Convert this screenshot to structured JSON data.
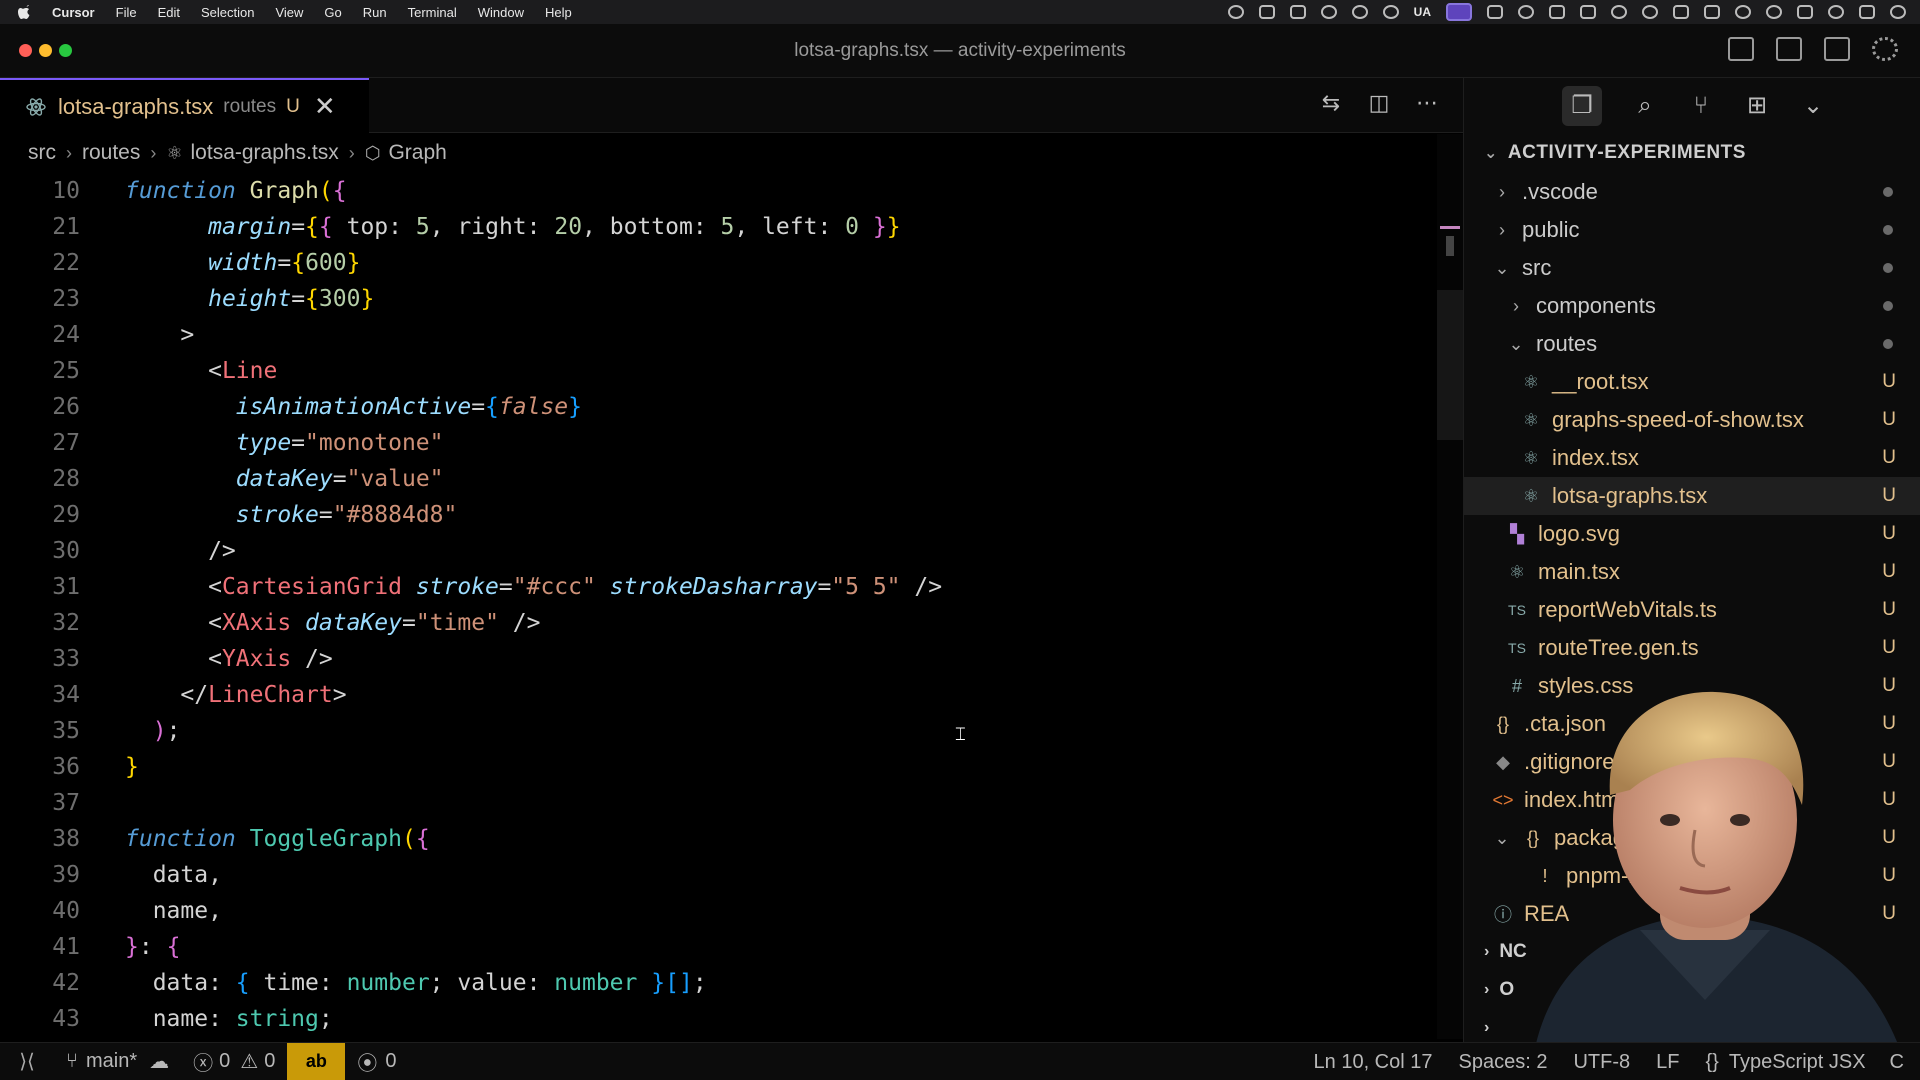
{
  "menubar": {
    "app": "Cursor",
    "items": [
      "File",
      "Edit",
      "Selection",
      "View",
      "Go",
      "Run",
      "Terminal",
      "Window",
      "Help"
    ],
    "tray_text": "UA"
  },
  "window": {
    "title": "lotsa-graphs.tsx — activity-experiments"
  },
  "tab": {
    "filename": "lotsa-graphs.tsx",
    "dir": "routes",
    "status": "U",
    "close": "✕"
  },
  "breadcrumb": {
    "parts": [
      "src",
      "routes",
      "lotsa-graphs.tsx",
      "Graph"
    ]
  },
  "code": {
    "line_numbers": [
      "10",
      "21",
      "22",
      "23",
      "24",
      "25",
      "26",
      "27",
      "28",
      "29",
      "30",
      "31",
      "32",
      "33",
      "34",
      "35",
      "36",
      "37",
      "38",
      "39",
      "40",
      "41",
      "42",
      "43"
    ]
  },
  "explorer": {
    "root": "ACTIVITY-EXPERIMENTS",
    "items": [
      {
        "label": ".vscode",
        "badge": ""
      },
      {
        "label": "public",
        "badge": ""
      },
      {
        "label": "src",
        "badge": ""
      },
      {
        "label": "components",
        "badge": ""
      },
      {
        "label": "routes",
        "badge": ""
      },
      {
        "label": "__root.tsx",
        "badge": "U"
      },
      {
        "label": "graphs-speed-of-show.tsx",
        "badge": "U"
      },
      {
        "label": "index.tsx",
        "badge": "U"
      },
      {
        "label": "lotsa-graphs.tsx",
        "badge": "U"
      },
      {
        "label": "logo.svg",
        "badge": "U"
      },
      {
        "label": "main.tsx",
        "badge": "U"
      },
      {
        "label": "reportWebVitals.ts",
        "badge": "U"
      },
      {
        "label": "routeTree.gen.ts",
        "badge": "U"
      },
      {
        "label": "styles.css",
        "badge": "U"
      },
      {
        "label": ".cta.json",
        "badge": "U"
      },
      {
        "label": ".gitignore",
        "badge": "U"
      },
      {
        "label": "index.html",
        "badge": "U"
      },
      {
        "label": "packag",
        "badge": "U"
      },
      {
        "label": "pnpm-l",
        "badge": "U"
      },
      {
        "label": "REA",
        "badge": "U"
      }
    ],
    "collapsed_sections": [
      "NC",
      "O",
      ""
    ]
  },
  "statusbar": {
    "branch": "main*",
    "errors": "0",
    "warnings": "0",
    "ab": "ab",
    "ports": "0",
    "position": "Ln 10, Col 17",
    "spaces": "Spaces: 2",
    "encoding": "UTF-8",
    "eol": "LF",
    "language": "TypeScript JSX",
    "trailing": "C"
  }
}
